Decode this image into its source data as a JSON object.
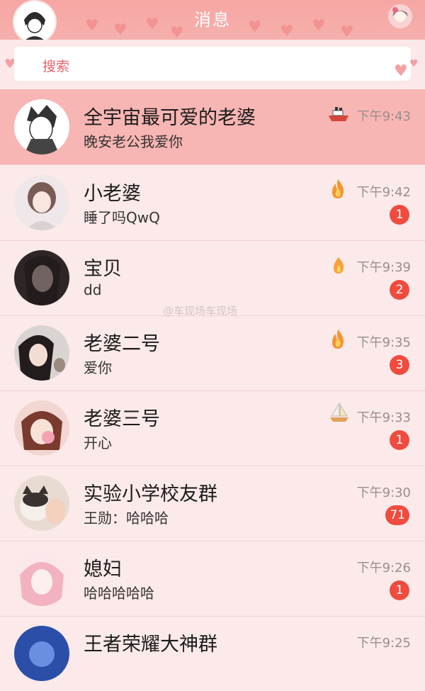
{
  "header": {
    "title": "消息"
  },
  "search": {
    "placeholder": "搜索"
  },
  "watermark": "@车现场车现场",
  "colors": {
    "header": "#f7a6a3",
    "active_row": "#f7b5b3",
    "badge": "#ef4b3e",
    "background": "#fce9e9"
  },
  "chats": [
    {
      "name": "全宇宙最可爱的老婆",
      "message": "晚安老公我爱你",
      "time": "下午9:43",
      "icon": "ship-icon",
      "unread": ""
    },
    {
      "name": "小老婆",
      "message": "睡了吗QwQ",
      "time": "下午9:42",
      "icon": "fire-icon",
      "unread": "1"
    },
    {
      "name": "宝贝",
      "message": "dd",
      "time": "下午9:39",
      "icon": "small-flame-icon",
      "unread": "2"
    },
    {
      "name": "老婆二号",
      "message": "爱你",
      "time": "下午9:35",
      "icon": "fire-icon",
      "unread": "3"
    },
    {
      "name": "老婆三号",
      "message": "开心",
      "time": "下午9:33",
      "icon": "sailboat-icon",
      "unread": "1"
    },
    {
      "name": "实验小学校友群",
      "message": "王勋：哈哈哈",
      "time": "下午9:30",
      "icon": "",
      "unread": "71"
    },
    {
      "name": "媳妇",
      "message": "哈哈哈哈哈",
      "time": "下午9:26",
      "icon": "",
      "unread": "1"
    },
    {
      "name": "王者荣耀大神群",
      "message": "",
      "time": "下午9:25",
      "icon": "",
      "unread": ""
    }
  ]
}
